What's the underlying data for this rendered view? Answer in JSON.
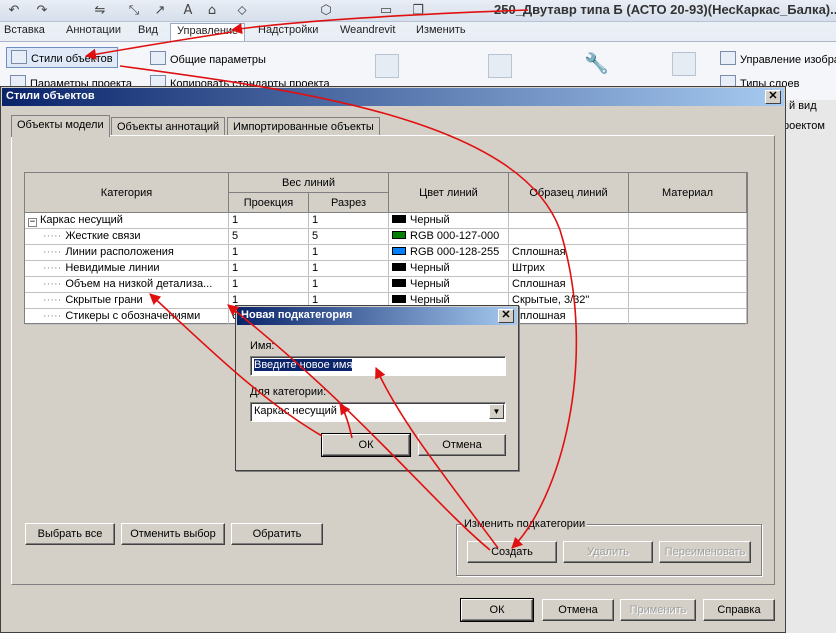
{
  "app_title": "250_Двутавр типа Б (АСТО 20-93)(НесКаркас_Балка)...",
  "ribbon_tabs": [
    {
      "label": "Вставка",
      "active": false
    },
    {
      "label": "Аннотации",
      "active": false
    },
    {
      "label": "Вид",
      "active": false
    },
    {
      "label": "Управление",
      "active": true
    },
    {
      "label": "Надстройки",
      "active": false
    },
    {
      "label": "Weandrevit",
      "active": false
    },
    {
      "label": "Изменить",
      "active": false
    }
  ],
  "ribbon": {
    "object_styles": "Стили объектов",
    "shared_params": "Общие параметры",
    "params_partial": "Параметры проекта",
    "copy_std_partial": "Копировать стандарты проекта",
    "manage_images": "Управление изобра",
    "layers_partial": "Типы слоев",
    "view_partial": "й вид",
    "project_partial": "роектом"
  },
  "dialog": {
    "title": "Стили объектов",
    "tabs": [
      "Объекты модели",
      "Объекты аннотаций",
      "Импортированные объекты"
    ],
    "columns": {
      "category": "Категория",
      "line_weight": "Вес линий",
      "projection": "Проекция",
      "cut": "Разрез",
      "line_color": "Цвет линий",
      "line_pattern": "Образец линий",
      "material": "Материал"
    },
    "rows": [
      {
        "name": "Каркас несущий",
        "proj": "1",
        "cut": "1",
        "color_name": "Черный",
        "color": "#000000",
        "pattern": "",
        "material": "",
        "root": true
      },
      {
        "name": "Жесткие связи",
        "proj": "5",
        "cut": "5",
        "color_name": "RGB 000-127-000",
        "color": "#007f00",
        "pattern": "",
        "material": ""
      },
      {
        "name": "Линии расположения",
        "proj": "1",
        "cut": "1",
        "color_name": "RGB 000-128-255",
        "color": "#0080ff",
        "pattern": "Сплошная",
        "material": ""
      },
      {
        "name": "Невидимые линии",
        "proj": "1",
        "cut": "1",
        "color_name": "Черный",
        "color": "#000000",
        "pattern": "Штрих",
        "material": ""
      },
      {
        "name": "Объем на низкой детализа...",
        "proj": "1",
        "cut": "1",
        "color_name": "Черный",
        "color": "#000000",
        "pattern": "Сплошная",
        "material": ""
      },
      {
        "name": "Скрытые грани",
        "proj": "1",
        "cut": "1",
        "color_name": "Черный",
        "color": "#000000",
        "pattern": "Скрытые, 3/32\"",
        "material": ""
      },
      {
        "name": "Стикеры с обозначениями",
        "proj": "6",
        "cut": "1",
        "color_name": "Черный",
        "color": "#000000",
        "pattern": "Сплошная",
        "material": ""
      }
    ],
    "buttons": {
      "select_all": "Выбрать все",
      "deselect": "Отменить выбор",
      "invert": "Обратить",
      "group_title": "Изменить подкатегории",
      "create": "Создать",
      "delete": "Удалить",
      "rename": "Переименовать",
      "ok": "ОК",
      "cancel": "Отмена",
      "apply": "Применить",
      "help": "Справка"
    }
  },
  "subdialog": {
    "title": "Новая подкатегория",
    "name_label": "Имя:",
    "name_value": "Введите новое имя",
    "category_label": "Для категории:",
    "category_value": "Каркас несущий",
    "ok": "ОК",
    "cancel": "Отмена"
  },
  "annotation_color": "#e01010"
}
